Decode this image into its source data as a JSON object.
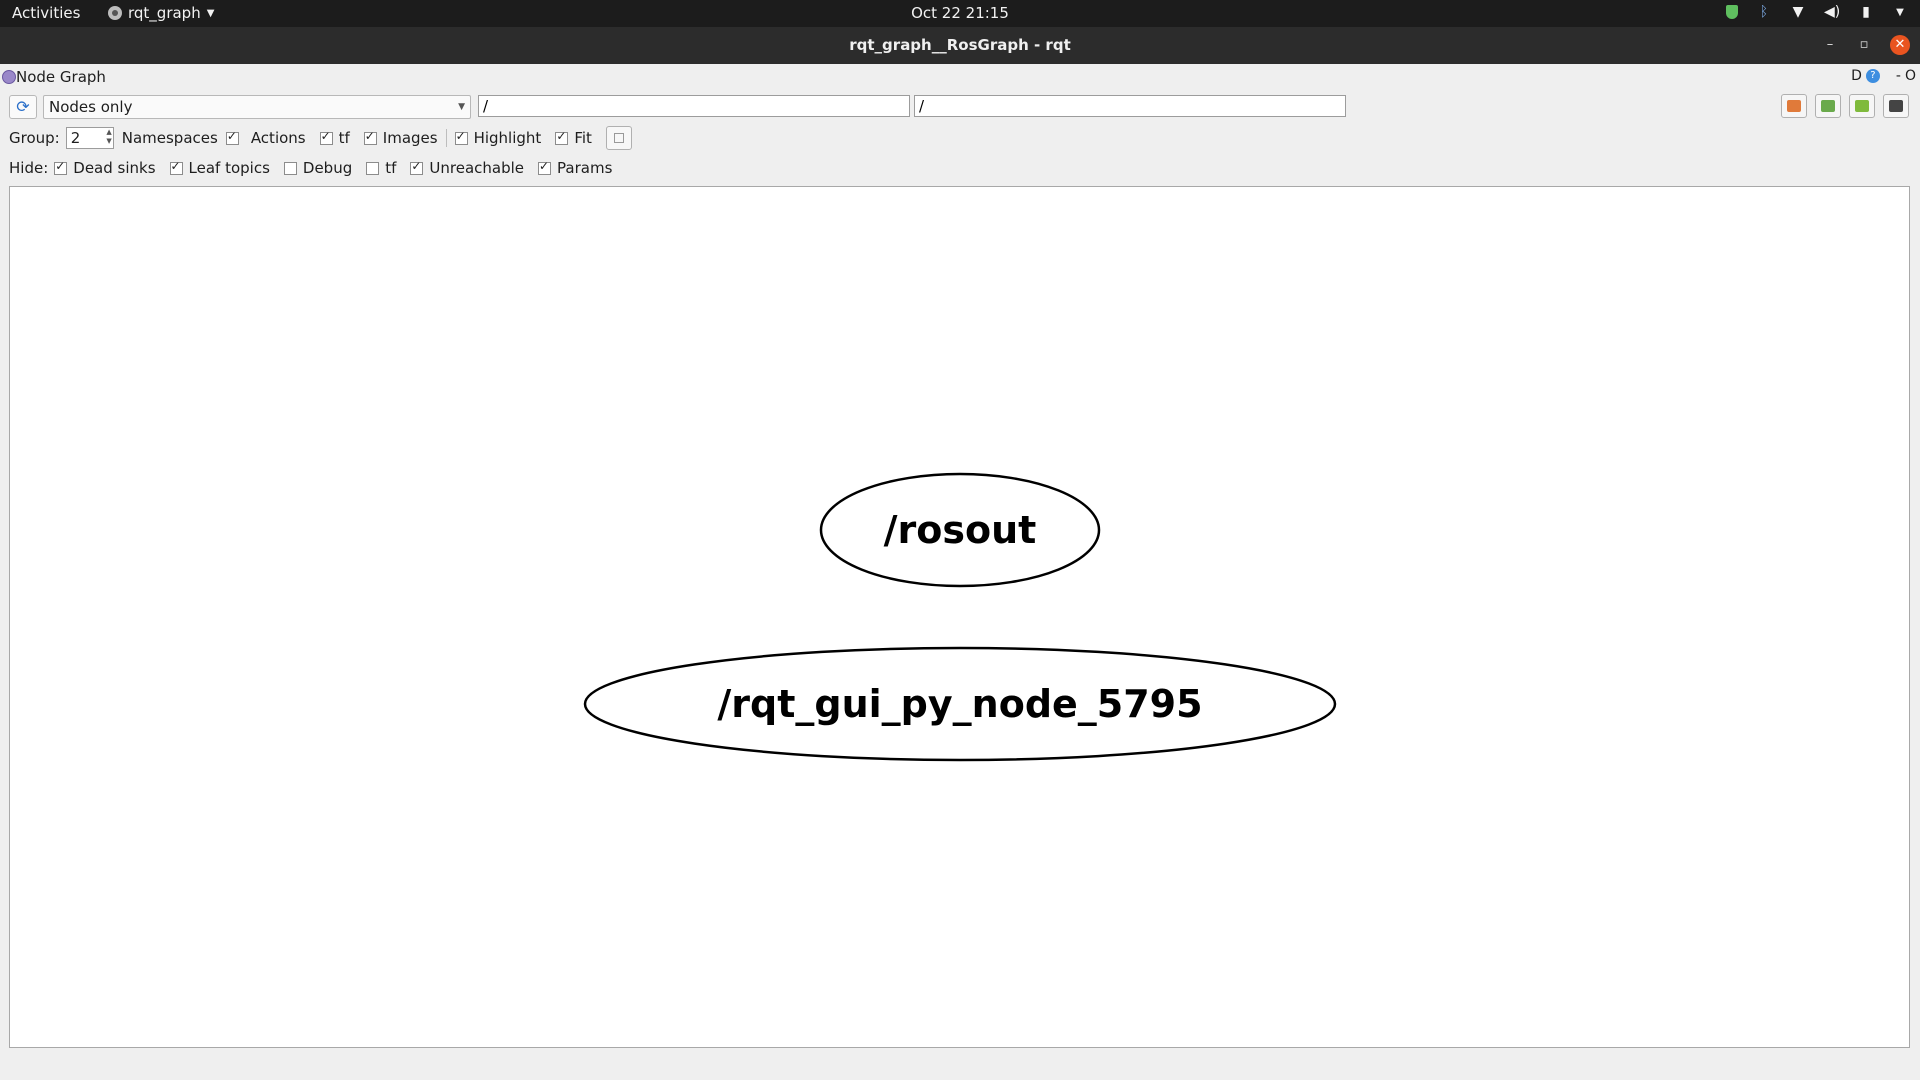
{
  "topbar": {
    "activities": "Activities",
    "app_name": "rqt_graph",
    "clock": "Oct 22  21:15"
  },
  "window": {
    "title": "rqt_graph__RosGraph - rqt"
  },
  "dock": {
    "title": "Node Graph",
    "d_label": "D",
    "dash": "-",
    "o_label": "O"
  },
  "toolbar": {
    "mode": "Nodes only",
    "filter_nodes": "/",
    "filter_topics": "/"
  },
  "options": {
    "group_label": "Group:",
    "group_value": "2",
    "namespaces": "Namespaces",
    "actions": "Actions",
    "tf": "tf",
    "images": "Images",
    "highlight": "Highlight",
    "fit": "Fit"
  },
  "hide": {
    "label": "Hide:",
    "dead_sinks": "Dead sinks",
    "leaf_topics": "Leaf topics",
    "debug": "Debug",
    "tf": "tf",
    "unreachable": "Unreachable",
    "params": "Params"
  },
  "graph": {
    "nodes": [
      "/rosout",
      "/rqt_gui_py_node_5795"
    ]
  },
  "colors": {
    "close_button": "#e95420",
    "refresh_icon": "#2a6fc9"
  }
}
